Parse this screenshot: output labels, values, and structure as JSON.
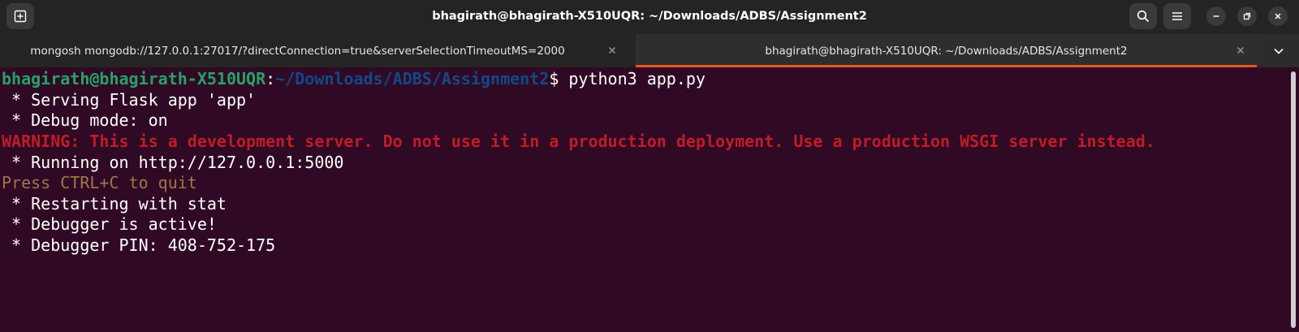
{
  "window": {
    "title": "bhagirath@bhagirath-X510UQR: ~/Downloads/ADBS/Assignment2"
  },
  "tabs": [
    {
      "label": "mongosh mongodb://127.0.0.1:27017/?directConnection=true&serverSelectionTimeoutMS=2000",
      "active": false
    },
    {
      "label": "bhagirath@bhagirath-X510UQR: ~/Downloads/ADBS/Assignment2",
      "active": true
    }
  ],
  "icons": {
    "new_tab": "new-tab-icon",
    "search": "search-icon",
    "menu": "hamburger-menu-icon",
    "minimize": "minimize-icon",
    "maximize": "restore-icon",
    "close": "close-icon",
    "tab_close": "close-icon",
    "tabs_dropdown": "chevron-down-icon"
  },
  "terminal": {
    "prompt_user": "bhagirath@bhagirath-X510UQR",
    "prompt_colon": ":",
    "prompt_path": "~/Downloads/ADBS/Assignment2",
    "prompt_command": "$ python3 app.py",
    "lines": [
      " * Serving Flask app 'app'",
      " * Debug mode: on",
      "WARNING: This is a development server. Do not use it in a production deployment. Use a production WSGI server instead.",
      " * Running on http://127.0.0.1:5000",
      "Press CTRL+C to quit",
      " * Restarting with stat",
      " * Debugger is active!",
      " * Debugger PIN: 408-752-175"
    ]
  },
  "colors": {
    "background": "#300a24",
    "prompt_user": "#26a269",
    "prompt_path": "#12488b",
    "warning": "#c01c28",
    "quit_hint": "#a2734c",
    "active_tab_accent": "#e95420"
  }
}
